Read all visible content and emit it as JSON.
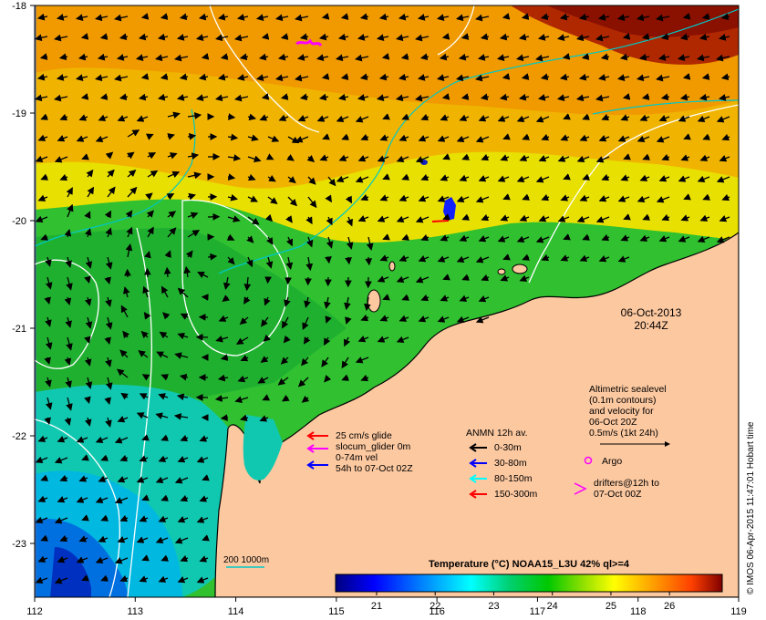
{
  "map": {
    "lon_ticks": [
      "112",
      "113",
      "114",
      "115",
      "116",
      "117",
      "118",
      "119"
    ],
    "lat_ticks": [
      "-18",
      "-19",
      "-20",
      "-21",
      "-22",
      "-23"
    ],
    "lon_range": [
      112,
      119
    ],
    "lat_range": [
      -23.5,
      -18
    ],
    "date": "06-Oct-2013",
    "time": "20:44Z"
  },
  "legend": {
    "altimetric_lines": [
      "Altimetric sealevel",
      "(0.1m contours)",
      "and velocity for",
      "06-Oct 20Z",
      "0.5m/s (1kt 24h)"
    ],
    "argo_label": "Argo",
    "drifters_lines": [
      "drifters@12h to",
      "07-Oct 00Z"
    ],
    "glider_lines": [
      "25 cm/s glide",
      "slocum_glider 0m",
      "0-74m vel",
      "54h to 07-Oct 02Z"
    ],
    "anmn_title": "ANMN 12h av.",
    "anmn_items": [
      {
        "label": "0-30m",
        "color": "#000000"
      },
      {
        "label": "30-80m",
        "color": "#0000ff"
      },
      {
        "label": "80-150m",
        "color": "#00ffff"
      },
      {
        "label": "150-300m",
        "color": "#ff0000"
      }
    ],
    "isobath_label": "200  1000m",
    "isobath_color": "#00c8c8"
  },
  "colorbar": {
    "title": "Temperature (°C) NOAA15_L3U 42% ql>=4",
    "ticks": [
      "21",
      "22",
      "23",
      "24",
      "25",
      "26"
    ],
    "colors": [
      "#00007f",
      "#0000ff",
      "#007fff",
      "#00ffff",
      "#00c85a",
      "#00c800",
      "#80e000",
      "#ffff00",
      "#ffa000",
      "#ff5000",
      "#c80000",
      "#800000"
    ]
  },
  "credit": "© IMOS 06-Apr-2015 11:47:01 Hobart time"
}
